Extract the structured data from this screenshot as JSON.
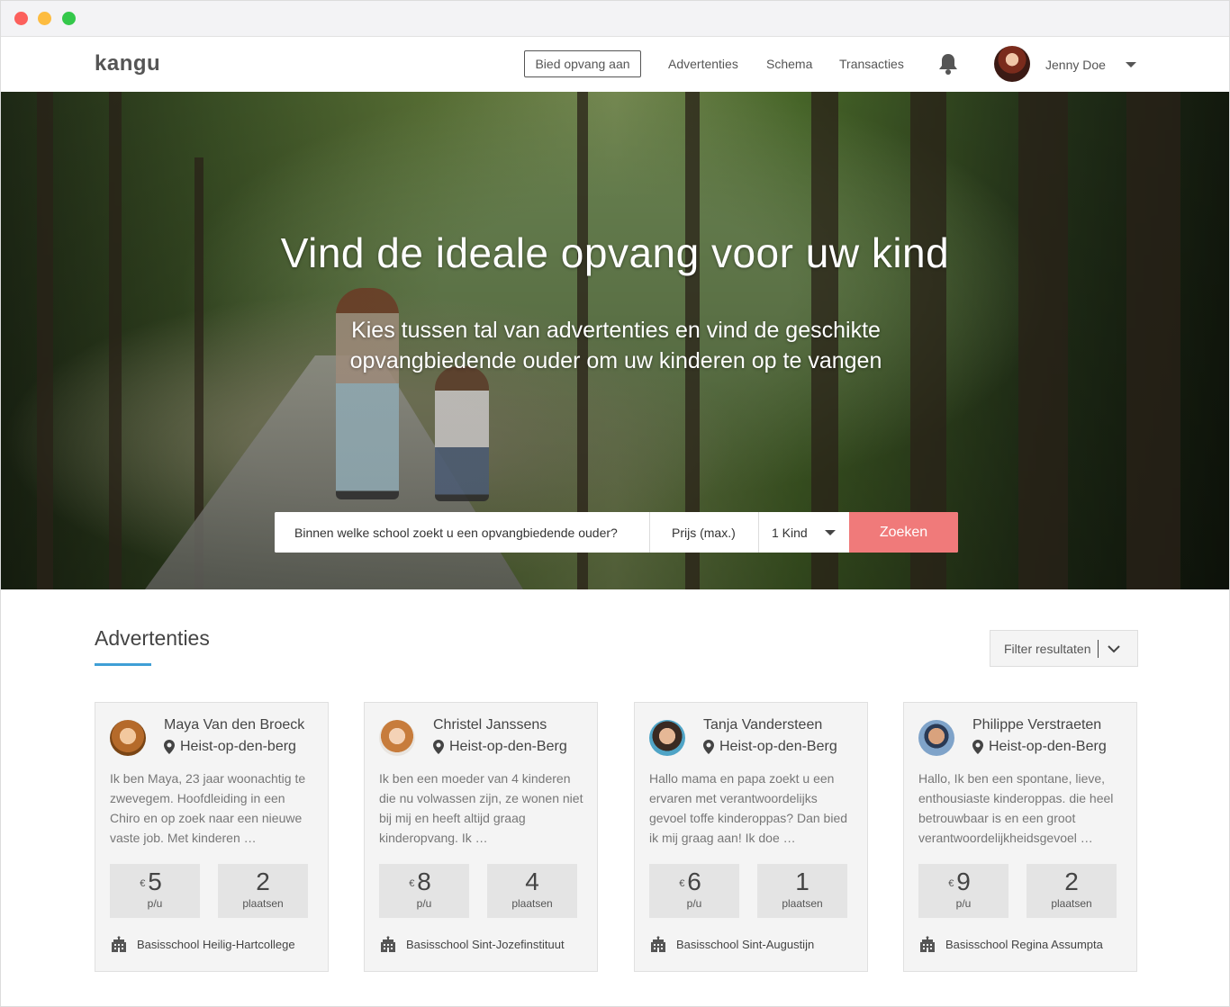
{
  "nav": {
    "logo": "kangu",
    "offer_button": "Bied opvang aan",
    "links": [
      "Advertenties",
      "Schema",
      "Transacties"
    ],
    "user_name": "Jenny Doe"
  },
  "hero": {
    "title": "Vind de ideale opvang voor uw kind",
    "subtitle_line1": "Kies tussen tal van advertenties en vind de geschikte",
    "subtitle_line2": "opvangbiedende ouder om uw kinderen op te vangen",
    "search": {
      "school_placeholder": "Binnen welke school zoekt u een opvangbiedende ouder?",
      "price_placeholder": "Prijs (max.)",
      "kids_value": "1 Kind",
      "button": "Zoeken"
    }
  },
  "listings": {
    "title": "Advertenties",
    "filter_label": "Filter resultaten",
    "currency": "€",
    "price_unit": "p/u",
    "places_unit": "plaatsen",
    "cards": [
      {
        "name": "Maya Van den Broeck",
        "location": "Heist-op-den-berg",
        "description": "Ik ben Maya, 23 jaar woonachtig te zwevegem. Hoofdleiding in een Chiro en op zoek naar een nieuwe vaste job. Met kinderen …",
        "price": "5",
        "places": "2",
        "school": "Basisschool Heilig-Hartcollege"
      },
      {
        "name": "Christel Janssens",
        "location": "Heist-op-den-Berg",
        "description": "Ik ben een moeder van 4 kinderen die nu volwassen zijn, ze wonen niet bij mij en heeft altijd graag kinderopvang. Ik …",
        "price": "8",
        "places": "4",
        "school": "Basisschool Sint-Jozefinstituut"
      },
      {
        "name": "Tanja Vandersteen",
        "location": "Heist-op-den-Berg",
        "description": "Hallo mama en papa zoekt u een ervaren met verantwoordelijks gevoel toffe kinderoppas? Dan bied ik mij graag aan! Ik doe …",
        "price": "6",
        "places": "1",
        "school": "Basisschool Sint-Augustijn"
      },
      {
        "name": "Philippe Verstraeten",
        "location": "Heist-op-den-Berg",
        "description": "Hallo, Ik ben een spontane, lieve, enthousiaste kinderoppas. die heel betrouwbaar is en een groot verantwoordelijkheidsgevoel …",
        "price": "9",
        "places": "2",
        "school": "Basisschool Regina Assumpta"
      }
    ]
  },
  "colors": {
    "accent": "#f07a7a",
    "underline": "#3f9fd6"
  }
}
